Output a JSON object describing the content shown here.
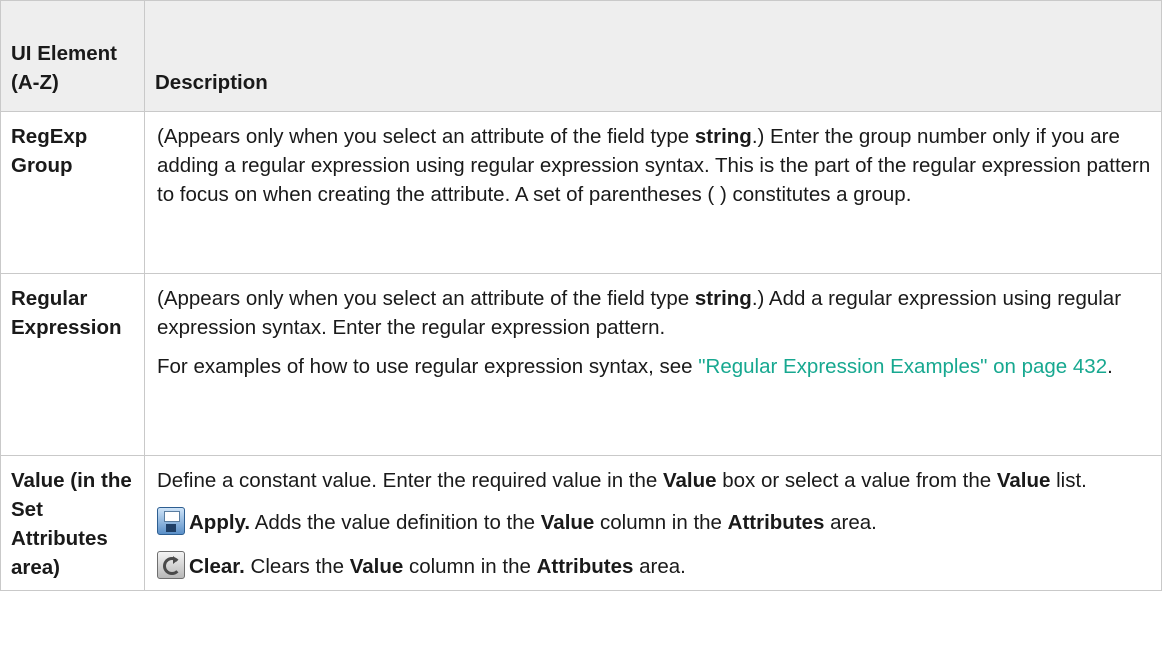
{
  "table": {
    "header": {
      "col1": "UI Element (A-Z)",
      "col2": "Description"
    },
    "rows": [
      {
        "element": "RegExp Group",
        "p1": {
          "t1": "(Appears only when you select an attribute of the field type ",
          "b1": "string",
          "t2": ".) Enter the group number only if you are adding a regular expression using regular expression syntax. This is the part of the regular expression pattern to focus on when creating the attribute. A set of parentheses ( ) constitutes a group."
        }
      },
      {
        "element": "Regular Expression",
        "p1": {
          "t1": "(Appears only when you select an attribute of the field type ",
          "b1": "string",
          "t2": ".) Add a regular expression using regular expression syntax. Enter the regular expression pattern."
        },
        "p2": {
          "t1": "For examples of how to use regular expression syntax, see ",
          "link": "\"Regular Expression Examples\" on page 432",
          "t2": "."
        }
      },
      {
        "element": "Value (in the Set Attributes area)",
        "p1": {
          "t1": "Define a constant value. Enter the required value in the ",
          "b1": "Value",
          "t2": " box or select a value from the ",
          "b2": "Value",
          "t3": " list."
        },
        "p2": {
          "icon": "save-icon",
          "b0": "Apply.",
          "t1": " Adds the value definition to the ",
          "b1": "Value",
          "t2": " column in the ",
          "b2": "Attributes",
          "t3": " area."
        },
        "p3": {
          "icon": "clear-icon",
          "b0": "Clear.",
          "t1": " Clears the ",
          "b1": "Value",
          "t2": " column in the ",
          "b2": "Attributes",
          "t3": " area."
        }
      }
    ]
  }
}
